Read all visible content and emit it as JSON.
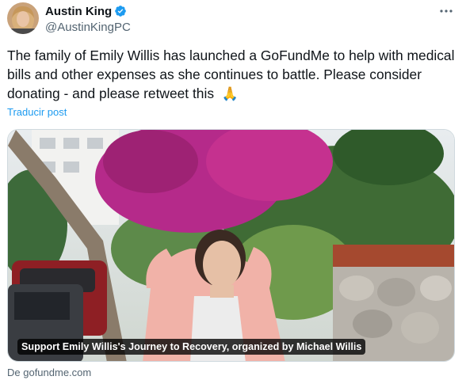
{
  "author": {
    "display_name": "Austin King",
    "handle": "@AustinKingPC",
    "verified": true,
    "verified_color": "#1d9bf0"
  },
  "tweet": {
    "text": "The family of Emily Willis has launched a GoFundMe to help with medical bills and other expenses as she continues to battle. Please consider donating - and please retweet this",
    "emoji": "🙏",
    "translate_label": "Traducir post"
  },
  "card": {
    "caption": "Support Emily Willis's Journey to Recovery, organized by Michael Willis",
    "source": "De gofundme.com"
  },
  "icons": {
    "more": "more-options-icon",
    "verified": "verified-badge-icon"
  },
  "colors": {
    "link": "#1d9bf0",
    "secondary_text": "#536471",
    "primary_text": "#0f1419"
  }
}
